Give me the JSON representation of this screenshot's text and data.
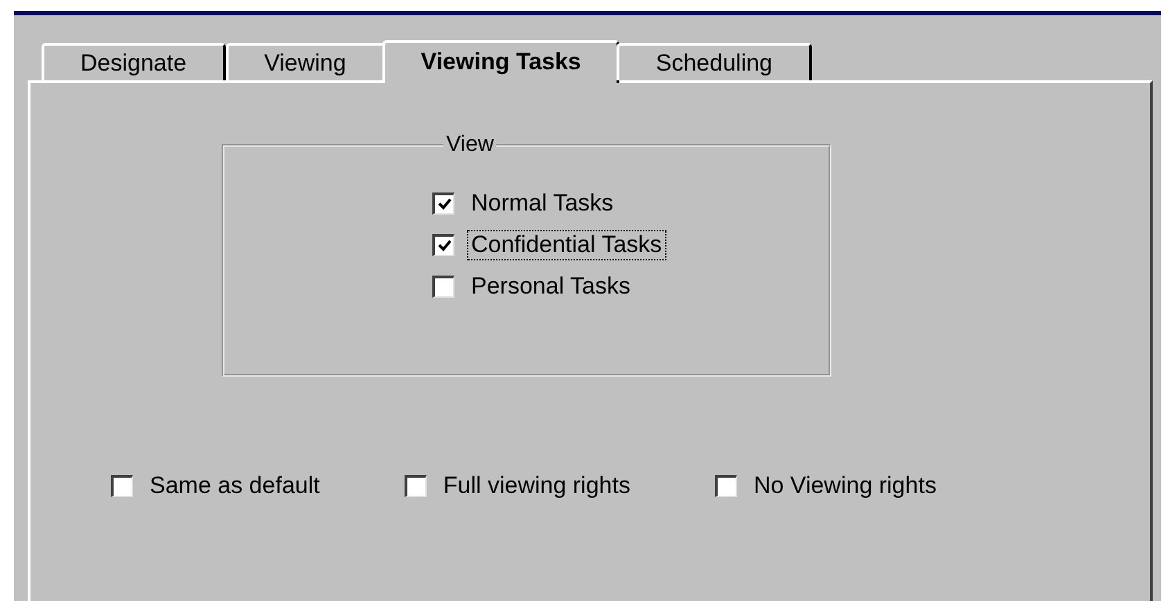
{
  "tabs": [
    {
      "label": "Designate",
      "selected": false
    },
    {
      "label": "Viewing",
      "selected": false
    },
    {
      "label": "Viewing Tasks",
      "selected": true
    },
    {
      "label": "Scheduling",
      "selected": false
    }
  ],
  "view_group": {
    "title": "View",
    "options": [
      {
        "label": "Normal Tasks",
        "checked": true,
        "focused": false
      },
      {
        "label": "Confidential Tasks",
        "checked": true,
        "focused": true
      },
      {
        "label": "Personal Tasks",
        "checked": false,
        "focused": false
      }
    ]
  },
  "rights_options": [
    {
      "label": "Same as default",
      "checked": false
    },
    {
      "label": "Full viewing rights",
      "checked": false
    },
    {
      "label": "No Viewing rights",
      "checked": false
    }
  ]
}
